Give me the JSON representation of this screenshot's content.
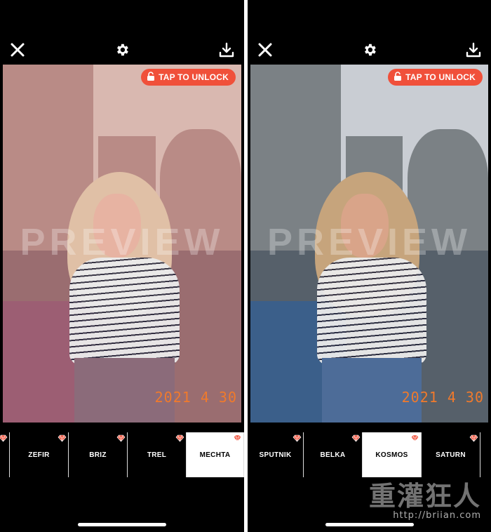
{
  "left": {
    "unlock_label": "TAP TO UNLOCK",
    "watermark": "PREVIEW",
    "datestamp": "2021  4  30",
    "filters": [
      {
        "label": "",
        "premium": true,
        "active": false
      },
      {
        "label": "ZEFIR",
        "premium": true,
        "active": false
      },
      {
        "label": "BRIZ",
        "premium": true,
        "active": false
      },
      {
        "label": "TREL",
        "premium": true,
        "active": false
      },
      {
        "label": "MECHTA",
        "premium": true,
        "active": true
      }
    ],
    "tone": {
      "sky": "#d9b8b0",
      "building": "#b98b86",
      "street": "#9a6d70",
      "rail": "#9c5e73",
      "hair": "#e0c0a6",
      "skin": "#e7b3a2",
      "jeans": "#8b6b7a"
    }
  },
  "right": {
    "unlock_label": "TAP TO UNLOCK",
    "watermark": "PREVIEW",
    "datestamp": "2021  4  30",
    "filters": [
      {
        "label": "SPUTNIK",
        "premium": true,
        "active": false
      },
      {
        "label": "BELKA",
        "premium": true,
        "active": false
      },
      {
        "label": "KOSMOS",
        "premium": true,
        "active": true
      },
      {
        "label": "SATURN",
        "premium": true,
        "active": false
      }
    ],
    "tone": {
      "sky": "#c9cdd3",
      "building": "#7b8185",
      "street": "#56606a",
      "rail": "#3b5f8a",
      "hair": "#c6a47c",
      "skin": "#d9a489",
      "jeans": "#4d6c98"
    }
  },
  "icons": {
    "close": "close-icon",
    "settings": "gear-icon",
    "download": "download-icon",
    "lock": "lock-icon",
    "premium": "diamond-icon"
  },
  "accent": "#f0503a",
  "site_watermark": {
    "cn": "重灌狂人",
    "url": "http://briian.com"
  }
}
